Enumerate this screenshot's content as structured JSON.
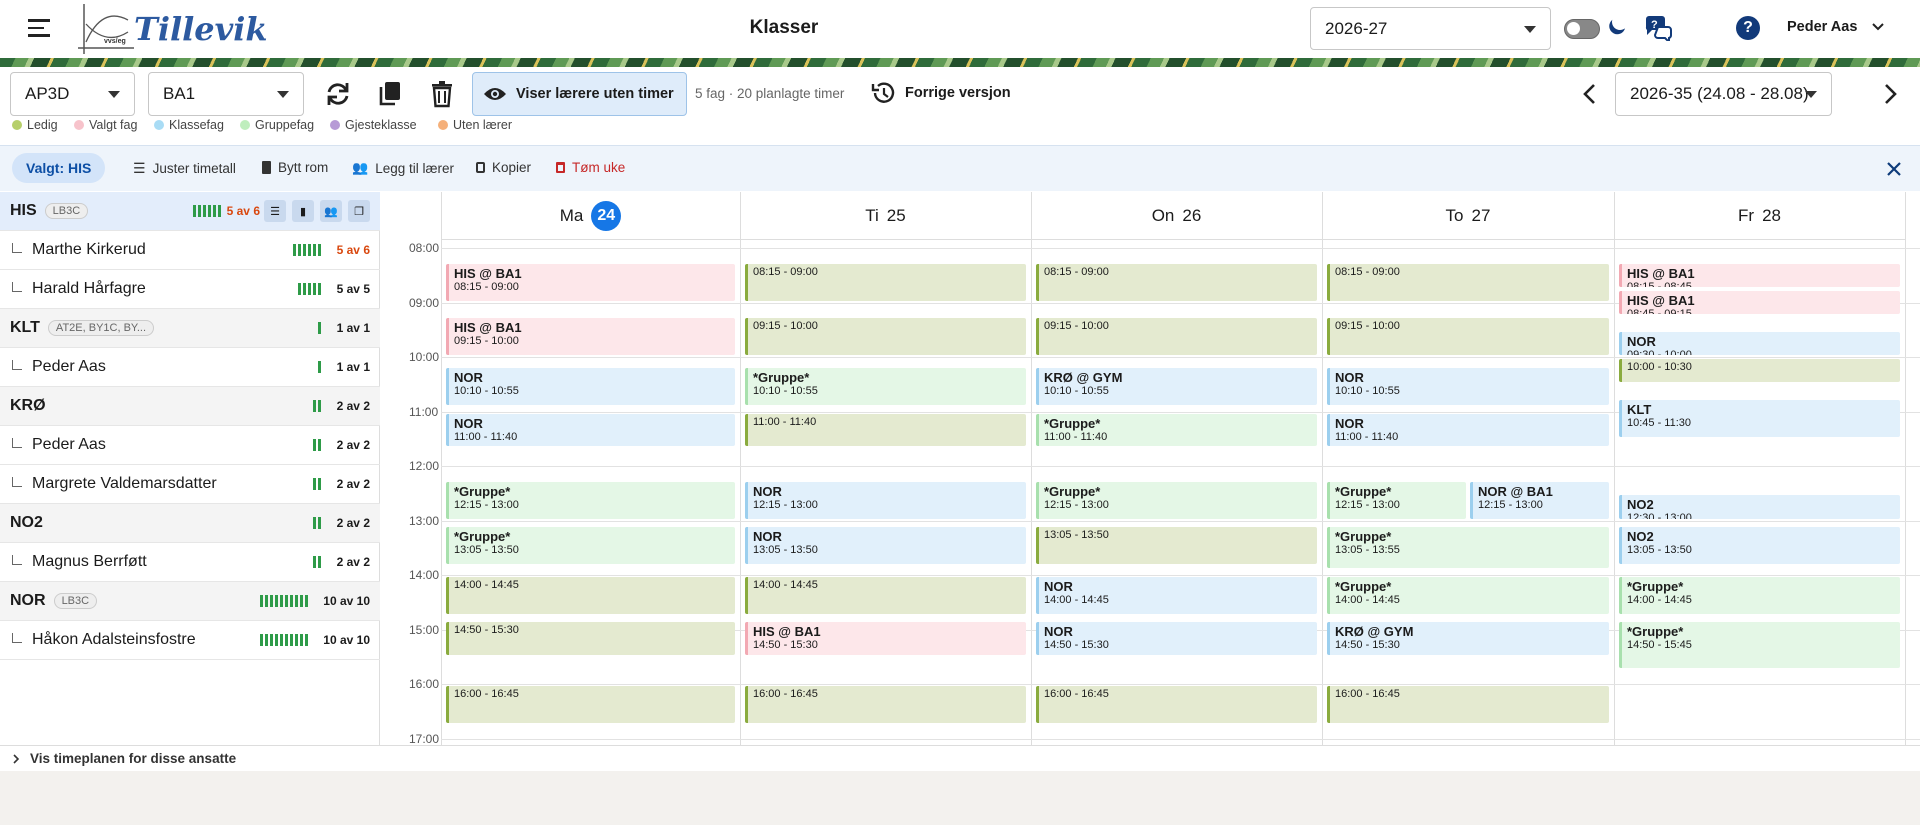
{
  "header": {
    "logo_text": "Tillevik",
    "logo_sub": "vvs/eg",
    "title": "Klasser",
    "year_select": "2026-27",
    "user_name": "Peder Aas"
  },
  "toolbar": {
    "class_select": "AP3D",
    "group_select": "BA1",
    "show_teachers_label": "Viser lærere uten timer",
    "summary": "5 fag · 20 planlagte timer",
    "prev_version_label": "Forrige versjon",
    "week_select": "2026-35 (24.08 - 28.08)"
  },
  "legend": [
    {
      "label": "Ledig",
      "color": "#b6cf6a"
    },
    {
      "label": "Valgt fag",
      "color": "#f7c3cb"
    },
    {
      "label": "Klassefag",
      "color": "#a9dcf5"
    },
    {
      "label": "Gruppefag",
      "color": "#bfeebd"
    },
    {
      "label": "Gjesteklasse",
      "color": "#b79ad6"
    },
    {
      "label": "Uten lærer",
      "color": "#f5b07a"
    }
  ],
  "selection_bar": {
    "chip": "Valgt: HIS",
    "actions": [
      "Juster timetall",
      "Bytt rom",
      "Legg til lærer",
      "Kopier",
      "Tøm uke"
    ]
  },
  "sidebar": {
    "rows": [
      {
        "kind": "subject",
        "name": "HIS",
        "tag": "LB3C",
        "bars": 6,
        "count": "5 av 6",
        "red": true,
        "active": true
      },
      {
        "kind": "teacher",
        "name": "Marthe Kirkerud",
        "bars": 6,
        "count": "5 av 6",
        "red": true
      },
      {
        "kind": "teacher",
        "name": "Harald Hårfagre",
        "bars": 5,
        "count": "5 av 5"
      },
      {
        "kind": "subject",
        "name": "KLT",
        "tag": "AT2E, BY1C, BY...",
        "bars": 1,
        "count": "1 av 1"
      },
      {
        "kind": "teacher",
        "name": "Peder Aas",
        "bars": 1,
        "count": "1 av 1"
      },
      {
        "kind": "subject",
        "name": "KRØ",
        "tag": "",
        "bars": 2,
        "count": "2 av 2"
      },
      {
        "kind": "teacher",
        "name": "Peder Aas",
        "bars": 2,
        "count": "2 av 2"
      },
      {
        "kind": "teacher",
        "name": "Margrete Valdemarsdatter",
        "bars": 2,
        "count": "2 av 2"
      },
      {
        "kind": "subject",
        "name": "NO2",
        "tag": "",
        "bars": 2,
        "count": "2 av 2"
      },
      {
        "kind": "teacher",
        "name": "Magnus Berrføtt",
        "bars": 2,
        "count": "2 av 2"
      },
      {
        "kind": "subject",
        "name": "NOR",
        "tag": "LB3C",
        "bars": 10,
        "count": "10 av 10"
      },
      {
        "kind": "teacher",
        "name": "Håkon Adalsteinsfostre",
        "bars": 10,
        "count": "10 av 10"
      }
    ]
  },
  "calendar": {
    "days": [
      {
        "name": "Ma",
        "num": "24",
        "today": true
      },
      {
        "name": "Ti",
        "num": "25"
      },
      {
        "name": "On",
        "num": "26"
      },
      {
        "name": "To",
        "num": "27"
      },
      {
        "name": "Fr",
        "num": "28"
      }
    ],
    "hours": [
      "08:00",
      "09:00",
      "10:00",
      "11:00",
      "12:00",
      "13:00",
      "14:00",
      "15:00",
      "16:00",
      "17:00"
    ],
    "events": [
      {
        "day": 0,
        "start": "08:15",
        "end": "09:00",
        "title": "HIS @ BA1",
        "time": "08:15 - 09:00",
        "type": "his"
      },
      {
        "day": 0,
        "start": "09:15",
        "end": "10:00",
        "title": "HIS @ BA1",
        "time": "09:15 - 10:00",
        "type": "his"
      },
      {
        "day": 0,
        "start": "10:10",
        "end": "10:55",
        "title": "NOR",
        "time": "10:10 - 10:55",
        "type": "nor"
      },
      {
        "day": 0,
        "start": "11:00",
        "end": "11:40",
        "title": "NOR",
        "time": "11:00 - 11:40",
        "type": "nor"
      },
      {
        "day": 0,
        "start": "12:15",
        "end": "13:00",
        "title": "*Gruppe*",
        "time": "12:15 - 13:00",
        "type": "grp"
      },
      {
        "day": 0,
        "start": "13:05",
        "end": "13:50",
        "title": "*Gruppe*",
        "time": "13:05 - 13:50",
        "type": "grp"
      },
      {
        "day": 0,
        "start": "14:00",
        "end": "14:45",
        "title": "",
        "time": "14:00 - 14:45",
        "type": "free"
      },
      {
        "day": 0,
        "start": "14:50",
        "end": "15:30",
        "title": "",
        "time": "14:50 - 15:30",
        "type": "free"
      },
      {
        "day": 0,
        "start": "16:00",
        "end": "16:45",
        "title": "",
        "time": "16:00 - 16:45",
        "type": "free"
      },
      {
        "day": 1,
        "start": "08:15",
        "end": "09:00",
        "title": "",
        "time": "08:15 - 09:00",
        "type": "free"
      },
      {
        "day": 1,
        "start": "09:15",
        "end": "10:00",
        "title": "",
        "time": "09:15 - 10:00",
        "type": "free"
      },
      {
        "day": 1,
        "start": "10:10",
        "end": "10:55",
        "title": "*Gruppe*",
        "time": "10:10 - 10:55",
        "type": "grp"
      },
      {
        "day": 1,
        "start": "11:00",
        "end": "11:40",
        "title": "",
        "time": "11:00 - 11:40",
        "type": "free"
      },
      {
        "day": 1,
        "start": "12:15",
        "end": "13:00",
        "title": "NOR",
        "time": "12:15 - 13:00",
        "type": "nor"
      },
      {
        "day": 1,
        "start": "13:05",
        "end": "13:50",
        "title": "NOR",
        "time": "13:05 - 13:50",
        "type": "nor"
      },
      {
        "day": 1,
        "start": "14:00",
        "end": "14:45",
        "title": "",
        "time": "14:00 - 14:45",
        "type": "free"
      },
      {
        "day": 1,
        "start": "14:50",
        "end": "15:30",
        "title": "HIS @ BA1",
        "time": "14:50 - 15:30",
        "type": "his"
      },
      {
        "day": 1,
        "start": "16:00",
        "end": "16:45",
        "title": "",
        "time": "16:00 - 16:45",
        "type": "free"
      },
      {
        "day": 2,
        "start": "08:15",
        "end": "09:00",
        "title": "",
        "time": "08:15 - 09:00",
        "type": "free"
      },
      {
        "day": 2,
        "start": "09:15",
        "end": "10:00",
        "title": "",
        "time": "09:15 - 10:00",
        "type": "free"
      },
      {
        "day": 2,
        "start": "10:10",
        "end": "10:55",
        "title": "KRØ @ GYM",
        "time": "10:10 - 10:55",
        "type": "nor"
      },
      {
        "day": 2,
        "start": "11:00",
        "end": "11:40",
        "title": "*Gruppe*",
        "time": "11:00 - 11:40",
        "type": "grp"
      },
      {
        "day": 2,
        "start": "12:15",
        "end": "13:00",
        "title": "*Gruppe*",
        "time": "12:15 - 13:00",
        "type": "grp"
      },
      {
        "day": 2,
        "start": "13:05",
        "end": "13:50",
        "title": "",
        "time": "13:05 - 13:50",
        "type": "free"
      },
      {
        "day": 2,
        "start": "14:00",
        "end": "14:45",
        "title": "NOR",
        "time": "14:00 - 14:45",
        "type": "nor"
      },
      {
        "day": 2,
        "start": "14:50",
        "end": "15:30",
        "title": "NOR",
        "time": "14:50 - 15:30",
        "type": "nor"
      },
      {
        "day": 2,
        "start": "16:00",
        "end": "16:45",
        "title": "",
        "time": "16:00 - 16:45",
        "type": "free"
      },
      {
        "day": 3,
        "start": "08:15",
        "end": "09:00",
        "title": "",
        "time": "08:15 - 09:00",
        "type": "free"
      },
      {
        "day": 3,
        "start": "09:15",
        "end": "10:00",
        "title": "",
        "time": "09:15 - 10:00",
        "type": "free"
      },
      {
        "day": 3,
        "start": "10:10",
        "end": "10:55",
        "title": "NOR",
        "time": "10:10 - 10:55",
        "type": "nor"
      },
      {
        "day": 3,
        "start": "11:00",
        "end": "11:40",
        "title": "NOR",
        "time": "11:00 - 11:40",
        "type": "nor"
      },
      {
        "day": 3,
        "start": "12:15",
        "end": "13:00",
        "title": "*Gruppe*",
        "time": "12:15 - 13:00",
        "type": "grp",
        "half": "left"
      },
      {
        "day": 3,
        "start": "12:15",
        "end": "13:00",
        "title": "NOR @ BA1",
        "time": "12:15 - 13:00",
        "type": "nor",
        "half": "right"
      },
      {
        "day": 3,
        "start": "13:05",
        "end": "13:55",
        "title": "*Gruppe*",
        "time": "13:05 - 13:55",
        "type": "grp"
      },
      {
        "day": 3,
        "start": "14:00",
        "end": "14:45",
        "title": "*Gruppe*",
        "time": "14:00 - 14:45",
        "type": "grp"
      },
      {
        "day": 3,
        "start": "14:50",
        "end": "15:30",
        "title": "KRØ @ GYM",
        "time": "14:50 - 15:30",
        "type": "nor"
      },
      {
        "day": 3,
        "start": "16:00",
        "end": "16:45",
        "title": "",
        "time": "16:00 - 16:45",
        "type": "free"
      },
      {
        "day": 4,
        "start": "08:15",
        "end": "08:45",
        "title": "HIS @ BA1",
        "time": "08:15 - 08:45",
        "type": "his"
      },
      {
        "day": 4,
        "start": "08:45",
        "end": "09:15",
        "title": "HIS @ BA1",
        "time": "08:45 - 09:15",
        "type": "his"
      },
      {
        "day": 4,
        "start": "09:30",
        "end": "10:00",
        "title": "NOR",
        "time": "09:30 - 10:00",
        "type": "nor"
      },
      {
        "day": 4,
        "start": "10:00",
        "end": "10:30",
        "title": "",
        "time": "10:00 - 10:30",
        "type": "free"
      },
      {
        "day": 4,
        "start": "10:45",
        "end": "11:30",
        "title": "KLT",
        "time": "10:45 - 11:30",
        "type": "klt"
      },
      {
        "day": 4,
        "start": "12:30",
        "end": "13:00",
        "title": "NO2",
        "time": "12:30 - 13:00",
        "type": "nor"
      },
      {
        "day": 4,
        "start": "13:05",
        "end": "13:50",
        "title": "NO2",
        "time": "13:05 - 13:50",
        "type": "nor"
      },
      {
        "day": 4,
        "start": "14:00",
        "end": "14:45",
        "title": "*Gruppe*",
        "time": "14:00 - 14:45",
        "type": "grp"
      },
      {
        "day": 4,
        "start": "14:50",
        "end": "15:45",
        "title": "*Gruppe*",
        "time": "14:50 - 15:45",
        "type": "grp"
      }
    ]
  },
  "footer": {
    "toggle_label": "Vis timeplanen for disse ansatte"
  }
}
